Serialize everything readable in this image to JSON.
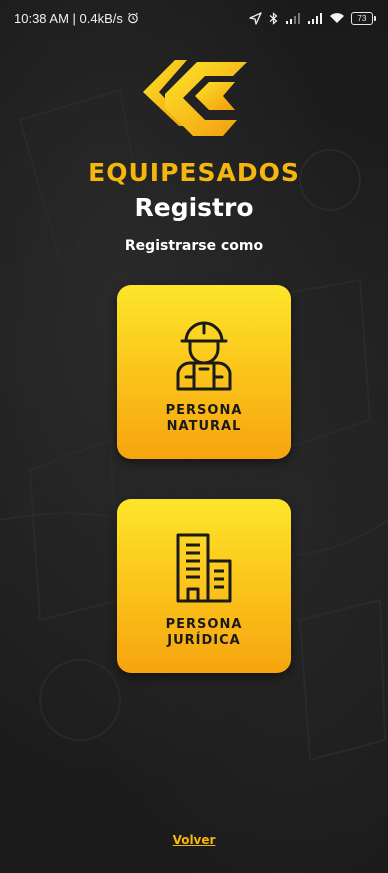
{
  "status_bar": {
    "time_speed": "10:38 AM | 0.4kB/s",
    "battery": "73"
  },
  "brand": {
    "name": "EQUIPESADOS",
    "color": "#f5b70e"
  },
  "header": {
    "title": "Registro",
    "subtitle": "Registrarse como"
  },
  "options": [
    {
      "line1": "PERSONA",
      "line2": "NATURAL",
      "icon": "worker-icon"
    },
    {
      "line1": "PERSONA",
      "line2": "JURÍDICA",
      "icon": "building-icon"
    }
  ],
  "footer": {
    "back_label": "Volver"
  },
  "colors": {
    "accent": "#f5b70e",
    "card_top": "#fde52b",
    "card_bottom": "#f6a40f",
    "background": "#1e1e1e"
  }
}
